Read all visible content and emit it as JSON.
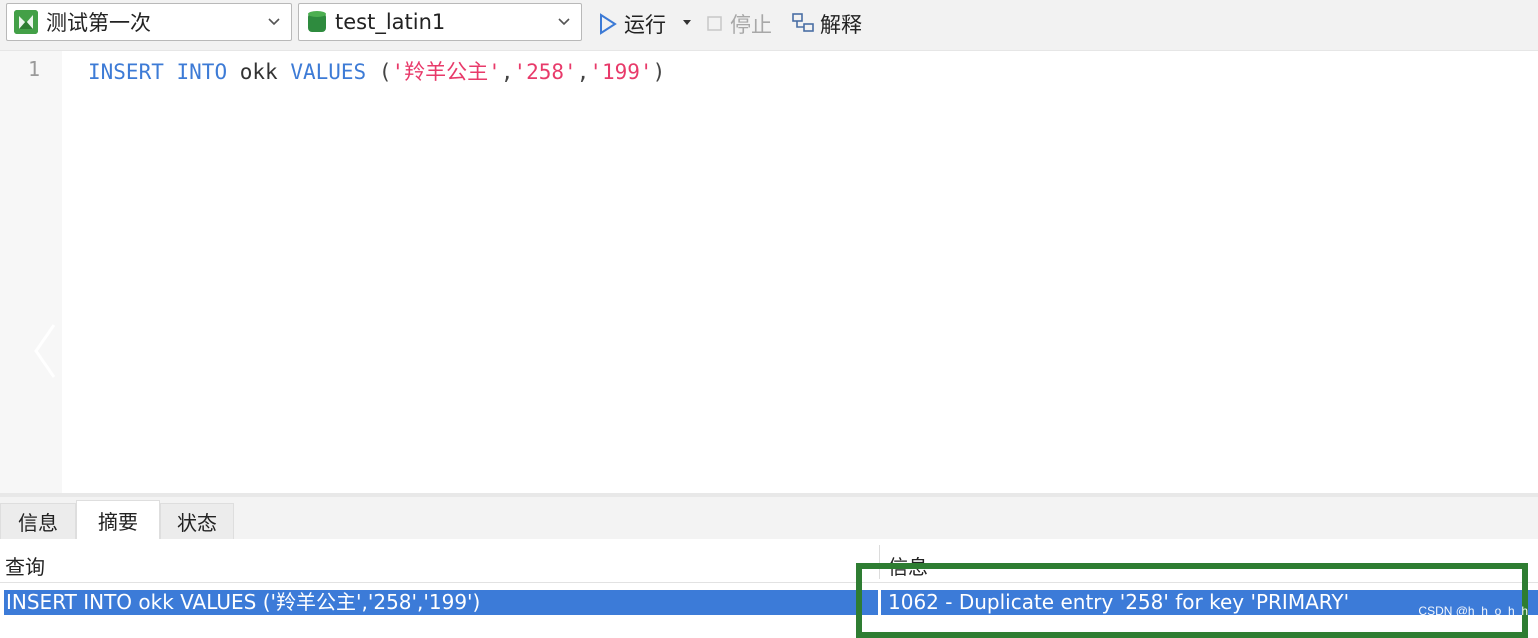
{
  "toolbar": {
    "connection_select": "测试第一次",
    "database_select": "test_latin1",
    "run_label": "运行",
    "stop_label": "停止",
    "explain_label": "解释"
  },
  "editor": {
    "line_number": "1",
    "tokens": {
      "kw_insert": "INSERT",
      "kw_into": "INTO",
      "table": "okk",
      "kw_values": "VALUES",
      "open_paren": "(",
      "val1": "'羚羊公主'",
      "comma1": ",",
      "val2": "'258'",
      "comma2": ",",
      "val3": "'199'",
      "close_paren": ")"
    }
  },
  "result_panel": {
    "tabs": [
      {
        "label": "信息",
        "active": false
      },
      {
        "label": "摘要",
        "active": true
      },
      {
        "label": "状态",
        "active": false
      }
    ],
    "columns": [
      "查询",
      "信息"
    ],
    "row": {
      "query": "INSERT INTO okk VALUES ('羚羊公主','258','199')",
      "message": "1062 - Duplicate entry '258' for key 'PRIMARY'"
    }
  },
  "watermark": "CSDN @h_h_o_h_h",
  "colors": {
    "keyword": "#3d7bd6",
    "string": "#e83a6a",
    "selection": "#3c7bd8",
    "highlight_box": "#2e7d32"
  },
  "icons": [
    "connection-icon",
    "database-icon",
    "chevron-down-icon",
    "play-icon",
    "stop-icon",
    "explain-icon",
    "chevron-left-icon"
  ]
}
